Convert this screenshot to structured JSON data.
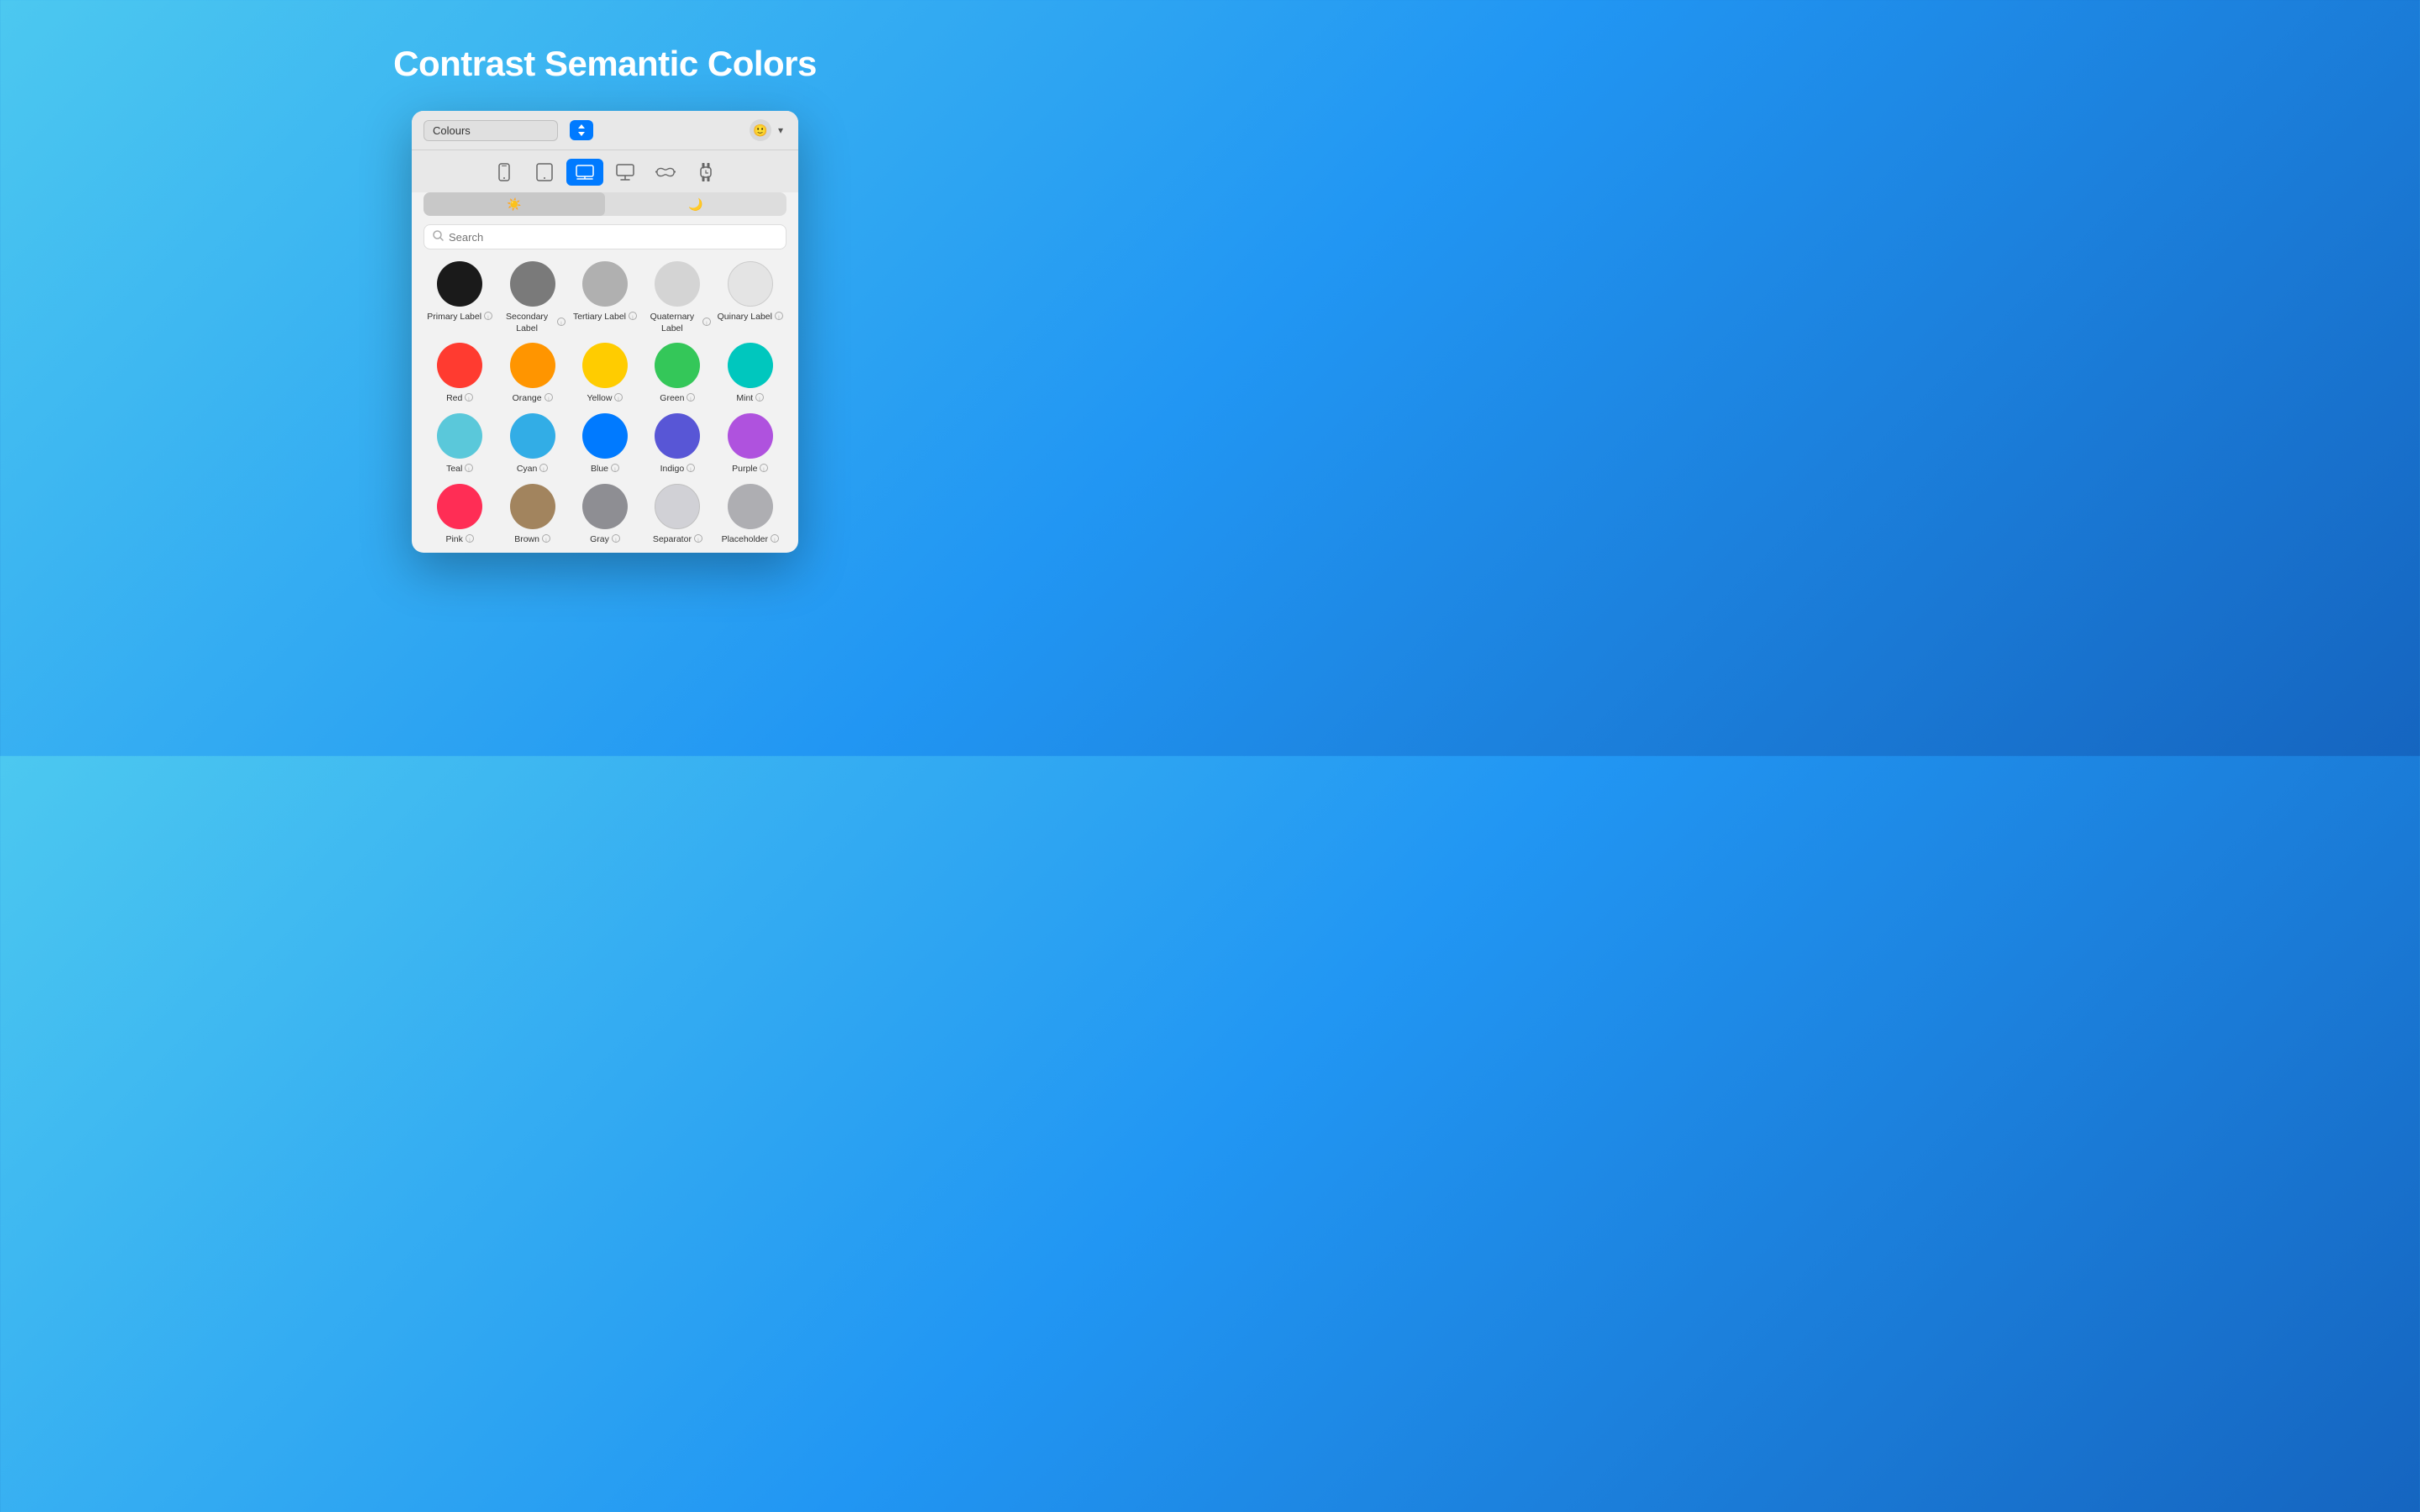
{
  "page": {
    "title": "Contrast Semantic Colors"
  },
  "panel": {
    "title": "Colours",
    "search_placeholder": "Search",
    "devices": [
      {
        "id": "phone",
        "icon": "📱",
        "label": "iPhone"
      },
      {
        "id": "tablet",
        "icon": "📋",
        "label": "iPad"
      },
      {
        "id": "mac",
        "icon": "🖥",
        "label": "Mac",
        "active": true
      },
      {
        "id": "monitor",
        "icon": "🖵",
        "label": "Monitor"
      },
      {
        "id": "vr",
        "icon": "🥽",
        "label": "Vision"
      },
      {
        "id": "watch",
        "icon": "⌚",
        "label": "Watch"
      }
    ],
    "theme_light": "☀",
    "theme_dark": "🌙",
    "colors": [
      {
        "id": "primary-label",
        "label": "Primary Label",
        "class": "c-primary-label"
      },
      {
        "id": "secondary-label",
        "label": "Secondary Label",
        "class": "c-secondary-label"
      },
      {
        "id": "tertiary-label",
        "label": "Tertiary Label",
        "class": "c-tertiary-label"
      },
      {
        "id": "quaternary-label",
        "label": "Quaternary Label",
        "class": "c-quaternary-label"
      },
      {
        "id": "quinary-label",
        "label": "Quinary Label",
        "class": "c-quinary-label"
      },
      {
        "id": "red",
        "label": "Red",
        "class": "c-red"
      },
      {
        "id": "orange",
        "label": "Orange",
        "class": "c-orange"
      },
      {
        "id": "yellow",
        "label": "Yellow",
        "class": "c-yellow"
      },
      {
        "id": "green",
        "label": "Green",
        "class": "c-green"
      },
      {
        "id": "mint",
        "label": "Mint",
        "class": "c-mint"
      },
      {
        "id": "teal",
        "label": "Teal",
        "class": "c-teal"
      },
      {
        "id": "cyan",
        "label": "Cyan",
        "class": "c-cyan"
      },
      {
        "id": "blue",
        "label": "Blue",
        "class": "c-blue"
      },
      {
        "id": "indigo",
        "label": "Indigo",
        "class": "c-indigo"
      },
      {
        "id": "purple",
        "label": "Purple",
        "class": "c-purple"
      },
      {
        "id": "pink",
        "label": "Pink",
        "class": "c-pink"
      },
      {
        "id": "brown",
        "label": "Brown",
        "class": "c-brown"
      },
      {
        "id": "gray",
        "label": "Gray",
        "class": "c-gray"
      },
      {
        "id": "separator",
        "label": "Separator",
        "class": "c-separator"
      },
      {
        "id": "placeholder",
        "label": "Placeholder",
        "class": "c-placeholder"
      }
    ]
  }
}
